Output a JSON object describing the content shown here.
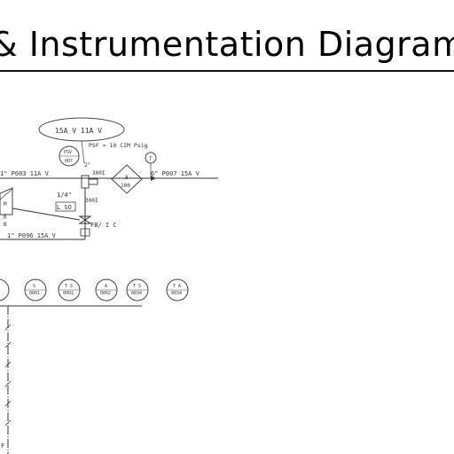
{
  "page": {
    "title": "& Instrumentation Diagram"
  },
  "diagram": {
    "top_callout": "15A  V    11A  V",
    "note_psi": "PSF = 10 CIM Psig",
    "bubble_left": {
      "tag": "PSV",
      "num": "007"
    },
    "bubble_right": {
      "tag": "T"
    },
    "label_7in": "2\"",
    "valve_3001": "300I",
    "diamond": {
      "top": "8",
      "bottom": "100"
    },
    "line_left_top": "1\" P003  11A  V",
    "line_right": "6\"  P007  15A  V",
    "label_quarter": "1/4\"",
    "label_ls": "L SO",
    "label_3001b": "300I",
    "left_box_labels": [
      "M",
      "R",
      "B"
    ],
    "fb_fc": "FB/ I C",
    "line_bottom": "1\"  P096  15A  V",
    "instrument_row": [
      {
        "tag": "",
        "num": ""
      },
      {
        "tag": "S",
        "num": "0001"
      },
      {
        "tag": "T S",
        "num": "0002"
      },
      {
        "tag": "A",
        "num": "0002"
      },
      {
        "tag": "T S",
        "num": "0034"
      },
      {
        "tag": "T A",
        "num": "0034"
      }
    ],
    "vertical_marker": "F"
  }
}
